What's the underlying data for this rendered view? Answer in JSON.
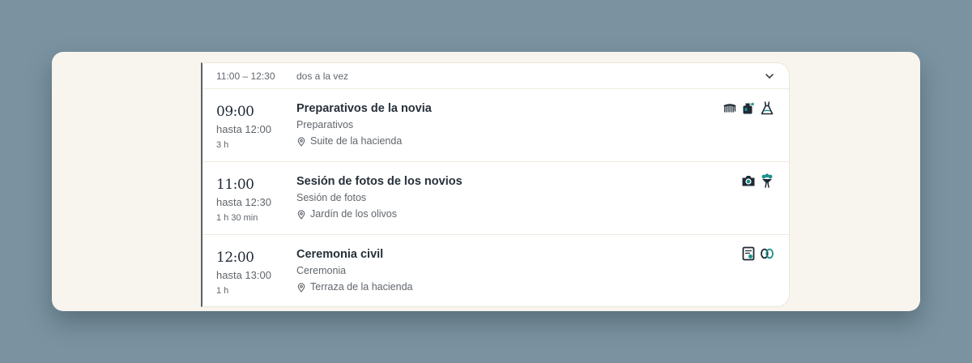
{
  "group": {
    "range": "11:00 – 12:30",
    "label": "dos a la vez"
  },
  "events": [
    {
      "start": "09:00",
      "until": "hasta 12:00",
      "duration": "3 h",
      "title": "Preparativos de la novia",
      "category": "Preparativos",
      "location": "Suite de la hacienda",
      "icons": [
        "comb-icon",
        "perfume-icon",
        "dress-icon"
      ]
    },
    {
      "start": "11:00",
      "until": "hasta 12:30",
      "duration": "1 h 30 min",
      "title": "Sesión de fotos de los novios",
      "category": "Sesión de fotos",
      "location": "Jardín de los olivos",
      "icons": [
        "camera-icon",
        "bouquet-icon"
      ]
    },
    {
      "start": "12:00",
      "until": "hasta 13:00",
      "duration": "1 h",
      "title": "Ceremonia civil",
      "category": "Ceremonia",
      "location": "Terraza de la hacienda",
      "icons": [
        "certificate-icon",
        "rings-icon"
      ]
    }
  ],
  "colors": {
    "icon_dark": "#1f2a35",
    "icon_accent": "#1b8f8a"
  }
}
